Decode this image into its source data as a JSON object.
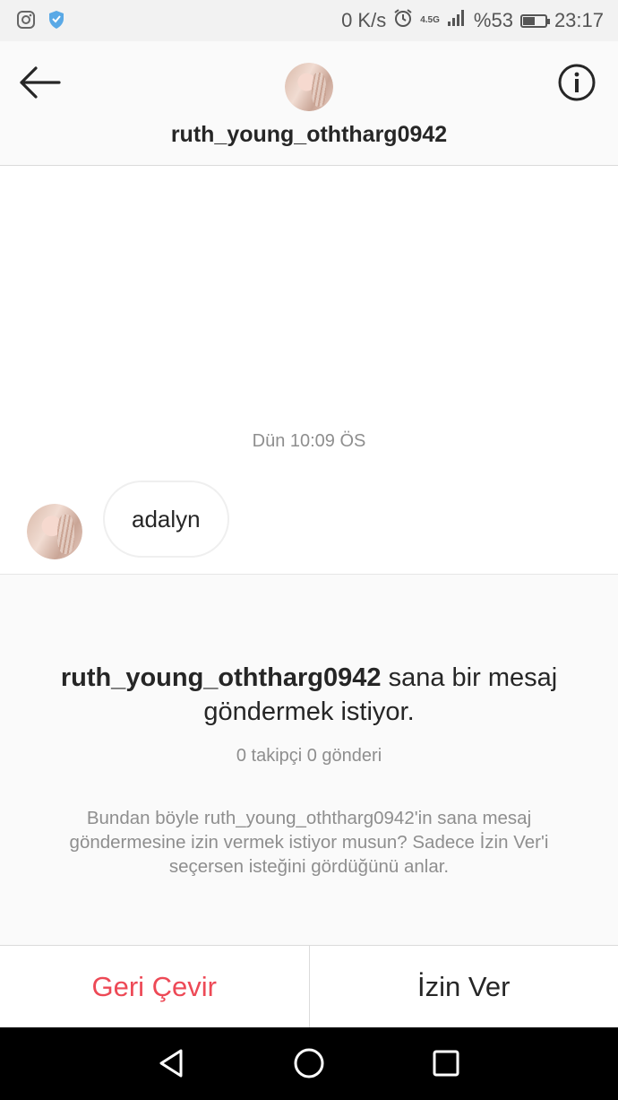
{
  "status_bar": {
    "net_speed": "0 K/s",
    "network_type": "4.5G",
    "battery_percent": "%53",
    "battery_level": 0.53,
    "time": "23:17",
    "icons": [
      "instagram-icon",
      "shield-icon",
      "alarm-icon",
      "signal-icon",
      "battery-icon"
    ]
  },
  "header": {
    "username": "ruth_young_oththarg0942",
    "icons": [
      "back-arrow-icon",
      "info-icon"
    ]
  },
  "conversation": {
    "timestamp": "Dün 10:09 ÖS",
    "messages": [
      {
        "text": "adalyn"
      }
    ]
  },
  "request": {
    "username": "ruth_young_oththarg0942",
    "title_suffix": " sana bir mesaj göndermek istiyor.",
    "stats": "0 takipçi 0 gönderi",
    "description": "Bundan böyle ruth_young_oththarg0942'in sana mesaj göndermesine izin vermek istiyor musun? Sadece İzin Ver'i seçersen isteğini gördüğünü anlar."
  },
  "actions": {
    "decline_label": "Geri Çevir",
    "accept_label": "İzin Ver",
    "decline_color": "#ed4956"
  },
  "nav_bar": {
    "icons": [
      "back-triangle-icon",
      "home-circle-icon",
      "recents-square-icon"
    ]
  }
}
